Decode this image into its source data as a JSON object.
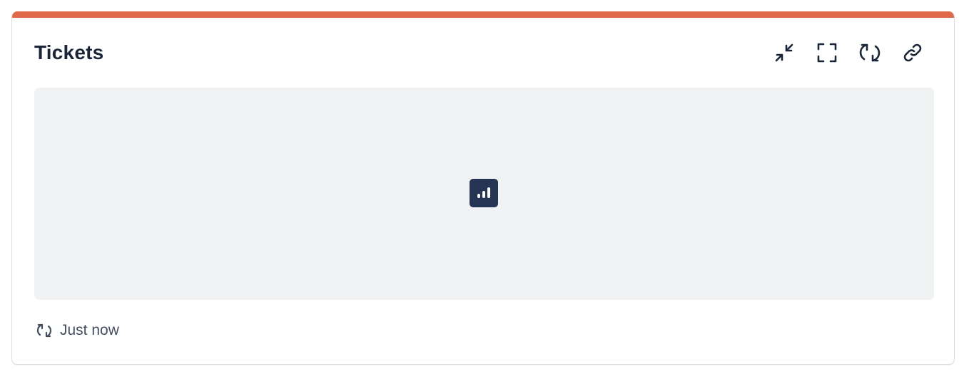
{
  "widget": {
    "title": "Tickets",
    "accent_color": "#e0694a",
    "toolbar": [
      {
        "name": "collapse",
        "icon": "collapse-icon"
      },
      {
        "name": "fullscreen",
        "icon": "fullscreen-icon"
      },
      {
        "name": "refresh",
        "icon": "refresh-icon"
      },
      {
        "name": "link",
        "icon": "link-icon"
      }
    ],
    "chart_placeholder_icon": "bar-chart-icon",
    "footer": {
      "icon": "refresh-icon",
      "updated_text": "Just now"
    }
  }
}
